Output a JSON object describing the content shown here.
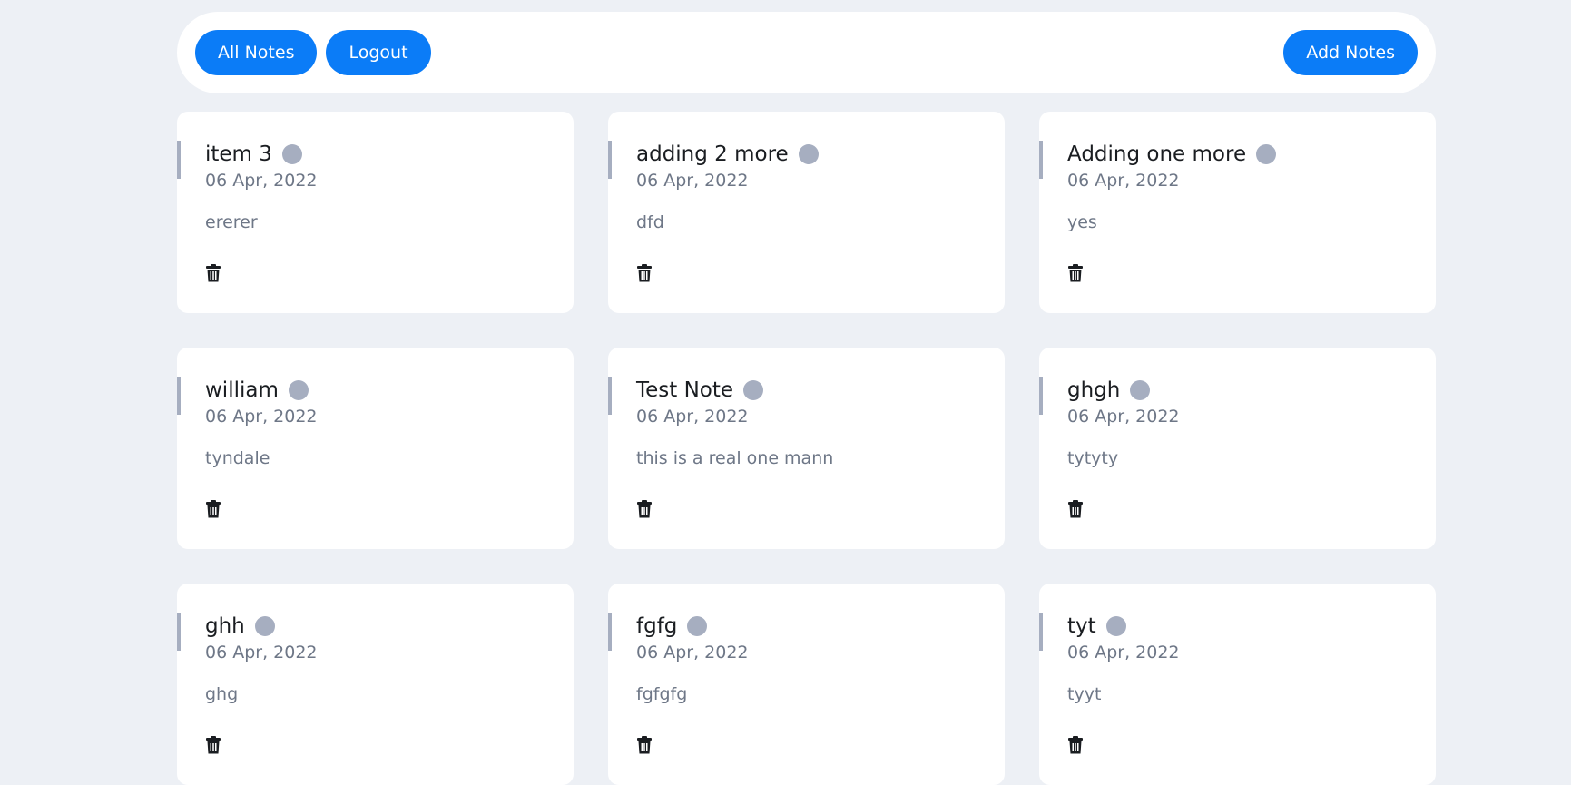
{
  "nav": {
    "all_notes_label": "All Notes",
    "logout_label": "Logout",
    "add_notes_label": "Add Notes"
  },
  "colors": {
    "accent": "#0b7cf7",
    "background": "#edf0f5",
    "status_dot": "#a6aec0"
  },
  "notes": [
    {
      "title": "item 3",
      "date": "06 Apr, 2022",
      "body": "ererer"
    },
    {
      "title": "adding 2 more",
      "date": "06 Apr, 2022",
      "body": "dfd"
    },
    {
      "title": "Adding one more",
      "date": "06 Apr, 2022",
      "body": "yes"
    },
    {
      "title": "william",
      "date": "06 Apr, 2022",
      "body": "tyndale"
    },
    {
      "title": "Test Note",
      "date": "06 Apr, 2022",
      "body": "this is a real one mann"
    },
    {
      "title": "ghgh",
      "date": "06 Apr, 2022",
      "body": "tytyty"
    },
    {
      "title": "ghh",
      "date": "06 Apr, 2022",
      "body": "ghg"
    },
    {
      "title": "fgfg",
      "date": "06 Apr, 2022",
      "body": "fgfgfg"
    },
    {
      "title": "tyt",
      "date": "06 Apr, 2022",
      "body": "tyyt"
    }
  ],
  "icons": {
    "delete": "trash-icon",
    "status": "status-dot"
  }
}
